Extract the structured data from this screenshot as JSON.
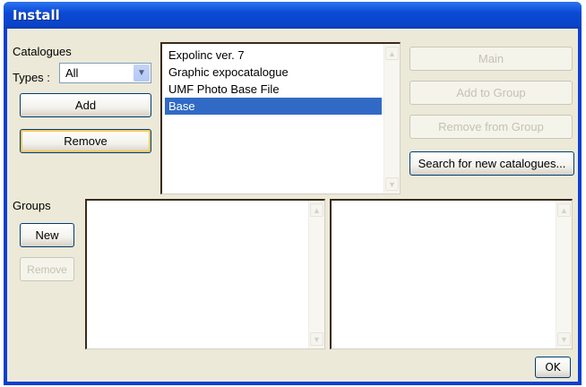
{
  "window": {
    "title": "Install"
  },
  "catalogues": {
    "label": "Catalogues",
    "types_label": "Types :",
    "types_value": "All",
    "add_label": "Add",
    "remove_label": "Remove",
    "items": [
      {
        "label": "Expolinc ver. 7",
        "selected": false
      },
      {
        "label": "Graphic expocatalogue",
        "selected": false
      },
      {
        "label": "UMF Photo Base File",
        "selected": false
      },
      {
        "label": "Base",
        "selected": true
      }
    ]
  },
  "actions": {
    "main_label": "Main",
    "add_to_group_label": "Add to Group",
    "remove_from_group_label": "Remove from Group",
    "search_label": "Search for new catalogues..."
  },
  "groups": {
    "label": "Groups",
    "new_label": "New",
    "remove_label": "Remove"
  },
  "footer": {
    "ok_label": "OK"
  },
  "colors": {
    "titlebar": "#0a4ad6",
    "selection": "#316ac5",
    "dialog_bg": "#ece9d8"
  }
}
